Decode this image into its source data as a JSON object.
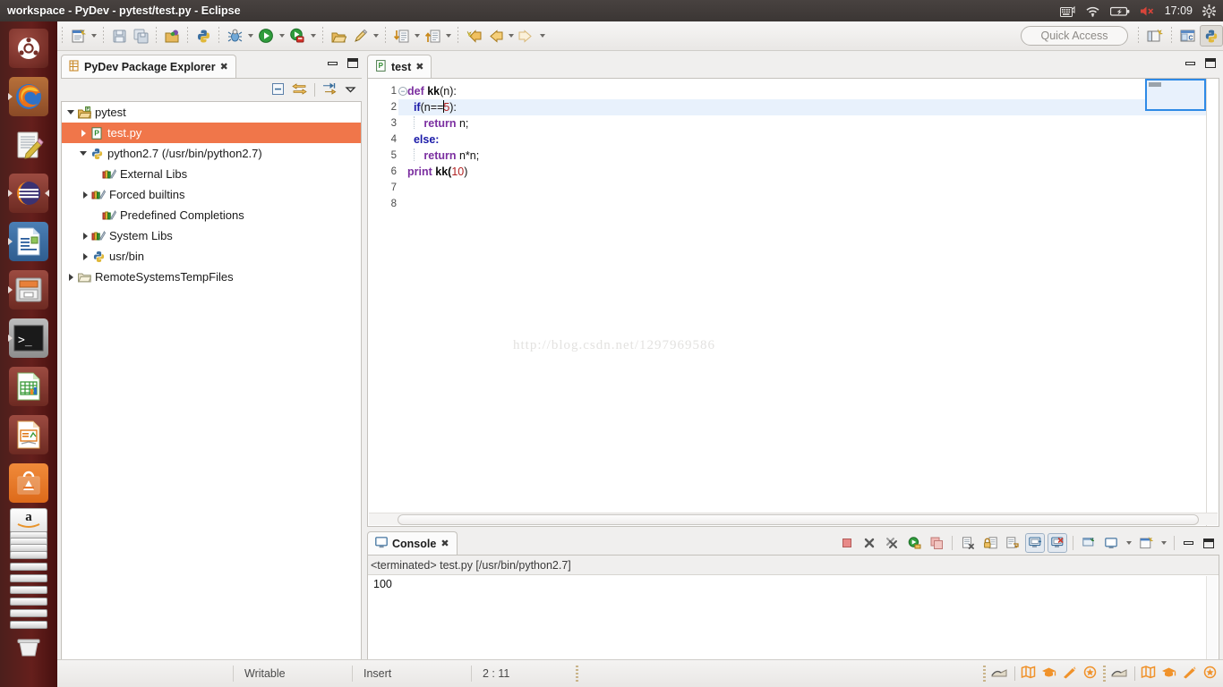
{
  "window": {
    "title": "workspace - PyDev - pytest/test.py - Eclipse",
    "clock": "17:09"
  },
  "tray": {
    "keyboard_icon": "keyboard-icon",
    "wifi_icon": "wifi-icon",
    "battery_icon": "battery-icon",
    "volume_icon": "volume-muted-icon",
    "gear_icon": "system-menu-icon"
  },
  "launcher": {
    "items": [
      {
        "name": "ubuntu-dash-icon",
        "label": "Dash home"
      },
      {
        "name": "firefox-icon",
        "label": "Firefox"
      },
      {
        "name": "text-editor-icon",
        "label": "Text Editor"
      },
      {
        "name": "eclipse-icon",
        "label": "Eclipse"
      },
      {
        "name": "libreoffice-writer-icon",
        "label": "LibreOffice Writer"
      },
      {
        "name": "files-icon",
        "label": "Files"
      },
      {
        "name": "terminal-icon",
        "label": "Terminal"
      },
      {
        "name": "libreoffice-calc-icon",
        "label": "LibreOffice Calc"
      },
      {
        "name": "libreoffice-impress-icon",
        "label": "LibreOffice Impress"
      },
      {
        "name": "software-center-icon",
        "label": "Ubuntu Software Center"
      },
      {
        "name": "amazon-icon",
        "label": "Amazon"
      },
      {
        "name": "workspace-switcher-icon",
        "label": "Workspace Switcher"
      },
      {
        "name": "trash-icon",
        "label": "Trash"
      }
    ]
  },
  "toolbar": {
    "quick_access_placeholder": "Quick Access",
    "groups": [
      [
        "new-icon",
        "save-icon",
        "save-all-icon"
      ],
      [
        "new-pydev-project-icon"
      ],
      [
        "python-icon"
      ],
      [
        "debug-icon",
        "run-icon",
        "coverage-icon"
      ],
      [
        "open-type-icon",
        "pin-icon"
      ],
      [
        "next-annotation-icon",
        "previous-annotation-icon"
      ],
      [
        "last-edit-location-icon",
        "back-icon",
        "forward-icon"
      ]
    ],
    "perspective": [
      "open-perspective-icon",
      "java-perspective-icon",
      "pydev-perspective-icon"
    ]
  },
  "package_explorer": {
    "tab_label": "PyDev Package Explorer",
    "tab_icon": "package-explorer-icon",
    "close_glyph": "✖",
    "view_tools": [
      "collapse-all-icon",
      "link-with-editor-icon",
      "focus-on-active-task-icon",
      "view-menu-icon"
    ],
    "minimize_label": "Minimize",
    "maximize_label": "Maximize",
    "tree": [
      {
        "label": "pytest",
        "icon": "project-icon",
        "indent": 0,
        "twisty": "open",
        "selected": false
      },
      {
        "label": "test.py",
        "icon": "python-file-icon",
        "indent": 1,
        "twisty": "closed",
        "selected": true
      },
      {
        "label": "python2.7  (/usr/bin/python2.7)",
        "icon": "python-interpreter-icon",
        "indent": 1,
        "twisty": "open",
        "selected": false
      },
      {
        "label": "External Libs",
        "icon": "library-icon",
        "indent": 2,
        "twisty": "none",
        "selected": false
      },
      {
        "label": "Forced builtins",
        "icon": "library-icon",
        "indent": 2,
        "twisty": "closed",
        "selected": false
      },
      {
        "label": "Predefined Completions",
        "icon": "library-icon",
        "indent": 2,
        "twisty": "none",
        "selected": false
      },
      {
        "label": "System Libs",
        "icon": "library-icon",
        "indent": 2,
        "twisty": "closed",
        "selected": false
      },
      {
        "label": "usr/bin",
        "icon": "python-interpreter-icon",
        "indent": 2,
        "twisty": "closed",
        "selected": false
      },
      {
        "label": "RemoteSystemsTempFiles",
        "icon": "folder-icon",
        "indent": 0,
        "twisty": "closed",
        "selected": false
      }
    ]
  },
  "editor": {
    "tab_label": "test",
    "tab_icon": "python-file-icon",
    "close_glyph": "✖",
    "watermark": "http://blog.csdn.net/1297969586",
    "lines": [
      {
        "no": "1",
        "fold": true,
        "highlight": false
      },
      {
        "no": "2",
        "fold": false,
        "highlight": true
      },
      {
        "no": "3",
        "fold": false,
        "highlight": false
      },
      {
        "no": "4",
        "fold": false,
        "highlight": false
      },
      {
        "no": "5",
        "fold": false,
        "highlight": false
      },
      {
        "no": "6",
        "fold": false,
        "highlight": false
      },
      {
        "no": "7",
        "fold": false,
        "highlight": false
      },
      {
        "no": "8",
        "fold": false,
        "highlight": false
      }
    ],
    "source": {
      "l1_def": "def ",
      "l1_name": "kk",
      "l1_rest": "(n):",
      "l2_if": "if",
      "l2_open": "(n==",
      "l2_num": "5",
      "l2_close": "):",
      "l3_return": "return",
      "l3_rest": " n;",
      "l4_else": "else:",
      "l5_return": "return",
      "l5_rest": " n*n;",
      "l6_print": "print",
      "l6_name": " kk(",
      "l6_num": "10",
      "l6_close": ")"
    }
  },
  "console": {
    "tab_label": "Console",
    "tab_icon": "console-icon",
    "close_glyph": "✖",
    "launch_header": "<terminated> test.py [/usr/bin/python2.7]",
    "output": "100",
    "tools": [
      "terminate-icon",
      "remove-launch-icon",
      "remove-all-terminated-icon",
      "relaunch-icon",
      "duplicate-icon",
      "clear-console-icon",
      "scroll-lock-icon",
      "word-wrap-icon",
      "show-console-on-output-icon",
      "show-console-on-error-icon",
      "pin-console-icon",
      "display-selected-console-icon",
      "open-console-icon"
    ]
  },
  "status_bar": {
    "writable": "Writable",
    "insert": "Insert",
    "position": "2 : 11",
    "right_icons": [
      "quick-view-icon",
      "map-icon",
      "mortarboard-icon",
      "wand-icon",
      "badge-icon"
    ]
  },
  "colors": {
    "selection_orange": "#f0764a",
    "line_highlight": "#e8f1fc",
    "hover_border": "#2e8ae6",
    "keyword_purple": "#7b2fa0",
    "keyword_blue": "#1a1aa8",
    "number_red": "#b02020",
    "launcher_bg": "#5d2019",
    "panel_bg": "#3b3634"
  }
}
